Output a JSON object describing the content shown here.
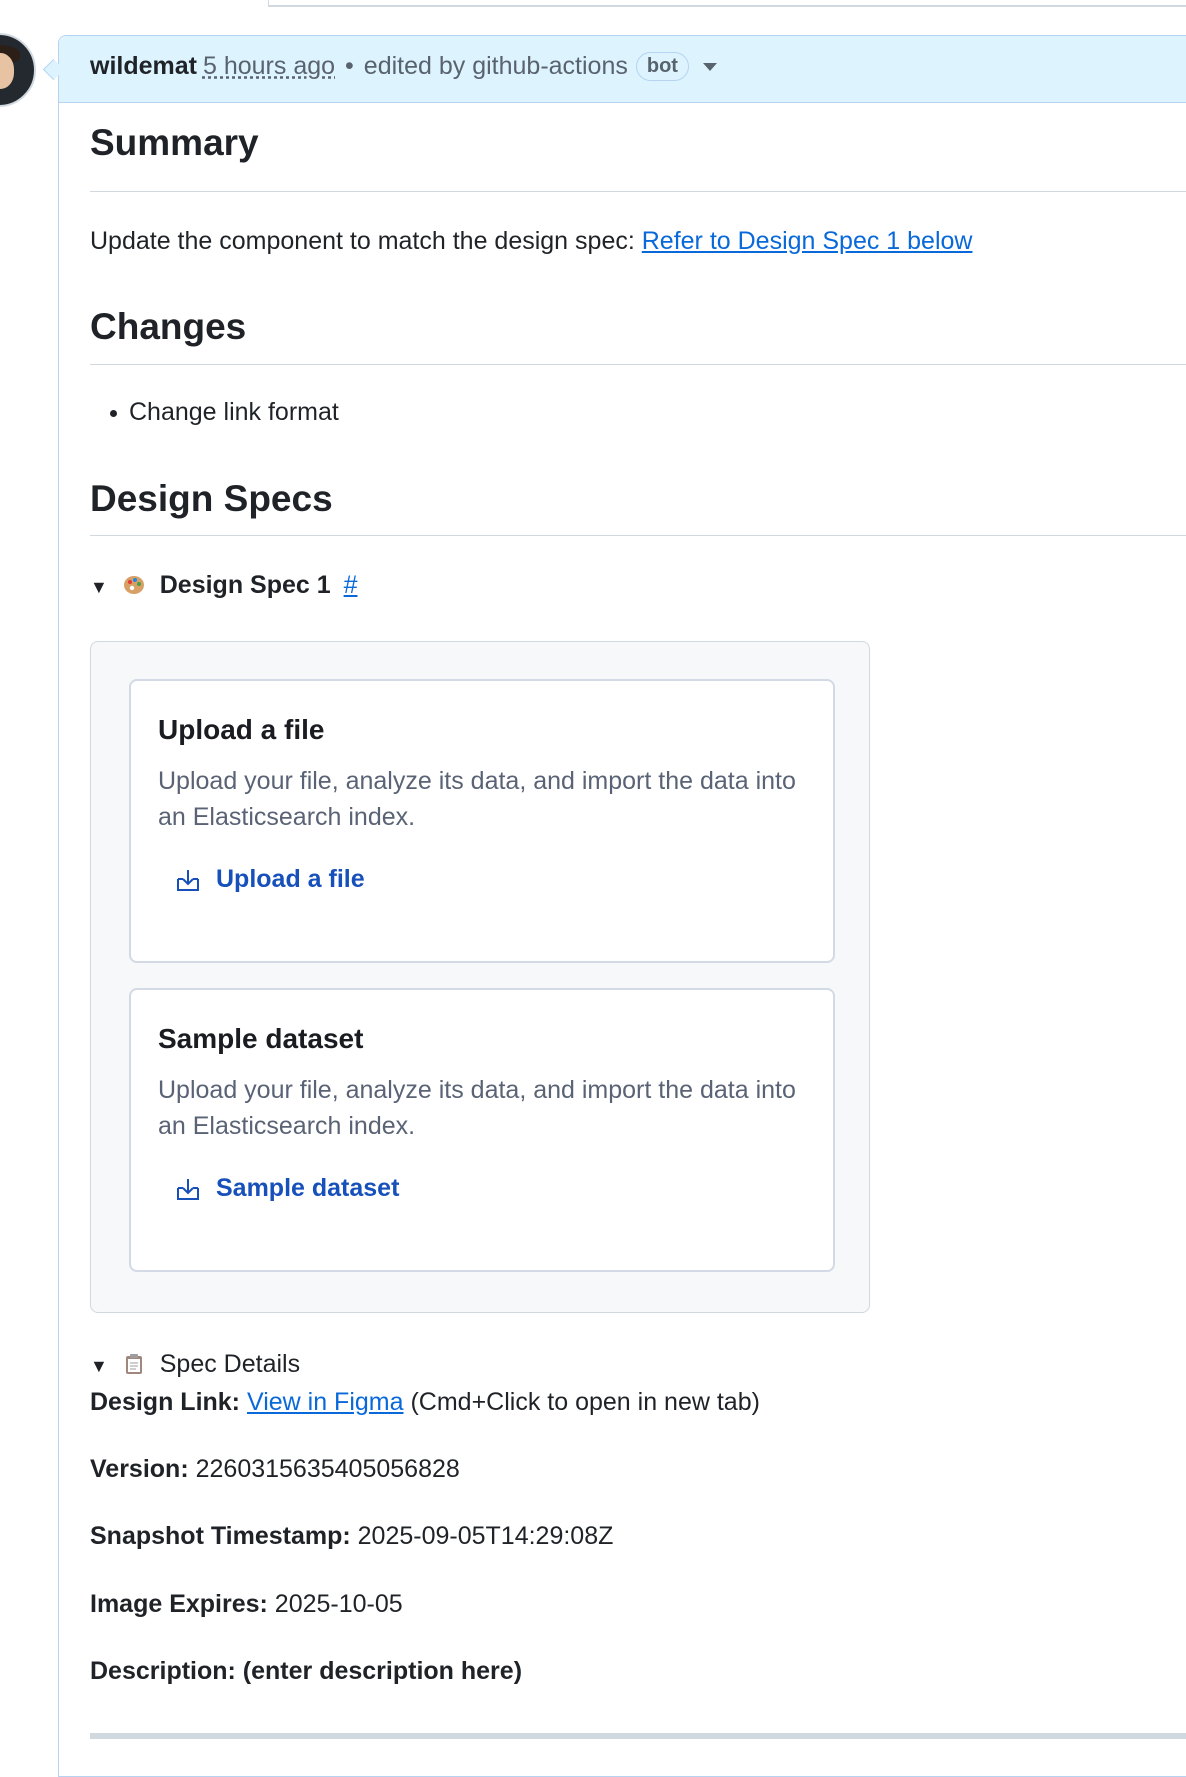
{
  "comment": {
    "author": "wildemat",
    "time": "5 hours ago",
    "separator": "•",
    "edited_by": "edited by github-actions",
    "badge": "bot"
  },
  "summary": {
    "heading": "Summary",
    "text": "Update the component to match the design spec: ",
    "link": "Refer to Design Spec 1 below"
  },
  "changes": {
    "heading": "Changes",
    "items": [
      "Change link format"
    ]
  },
  "design_specs": {
    "heading": "Design Specs",
    "spec1_title": "Design Spec 1",
    "spec1_anchor": "#",
    "cards": [
      {
        "title": "Upload a file",
        "description": "Upload your file, analyze its data, and import the data into an Elasticsearch index.",
        "action": "Upload a file"
      },
      {
        "title": "Sample dataset",
        "description": "Upload your file, analyze its data, and import the data into an Elasticsearch index.",
        "action": "Sample dataset"
      }
    ]
  },
  "spec_details": {
    "summary": "Spec Details",
    "design_link_label": "Design Link:",
    "design_link_text": "View in Figma",
    "design_link_note": " (Cmd+Click to open in new tab)",
    "version_label": "Version:",
    "version_value": " 2260315635405056828",
    "snapshot_label": "Snapshot Timestamp:",
    "snapshot_value": " 2025-09-05T14:29:08Z",
    "expires_label": "Image Expires:",
    "expires_value": " 2025-10-05",
    "description_label": "Description: (enter description here)"
  },
  "colors": {
    "link": "#0969da",
    "header_bg": "#ddf4ff",
    "eui_link": "#1750ba"
  },
  "icons": [
    "expand-triangle-icon",
    "palette-icon",
    "clipboard-icon",
    "import-icon",
    "dropdown-caret-icon"
  ]
}
